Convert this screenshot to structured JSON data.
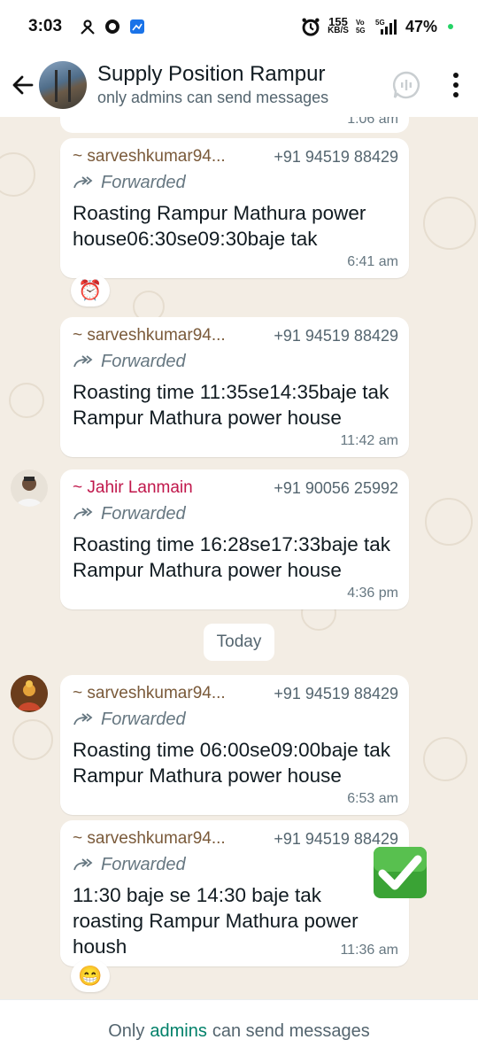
{
  "status_bar": {
    "time": "3:03",
    "net_speed_value": "155",
    "net_speed_unit": "KB/S",
    "volte": "Vo 5G",
    "network": "5G",
    "battery": "47%"
  },
  "header": {
    "group_name": "Supply Position Rampur",
    "subtitle": "only admins can send messages"
  },
  "chat": {
    "prev_time": "1:06 am",
    "forwarded_label": "Forwarded",
    "date_divider": "Today",
    "messages": [
      {
        "sender": "~ sarveshkumar94...",
        "phone": "+91 94519 88429",
        "text": "Roasting Rampur Mathura power house06:30se09:30baje tak",
        "time": "6:41 am",
        "reaction": "⏰"
      },
      {
        "sender": "~ sarveshkumar94...",
        "phone": "+91 94519 88429",
        "text": "Roasting time 11:35se14:35baje tak Rampur Mathura power house",
        "time": "11:42 am"
      },
      {
        "sender": "~ Jahir Lanmain",
        "phone": "+91 90056 25992",
        "text": "Roasting time 16:28se17:33baje tak Rampur Mathura power house",
        "time": "4:36 pm"
      },
      {
        "sender": "~ sarveshkumar94...",
        "phone": "+91 94519 88429",
        "text": "Roasting time 06:00se09:00baje tak Rampur Mathura power house",
        "time": "6:53 am"
      },
      {
        "sender": "~ sarveshkumar94...",
        "phone": "+91 94519 88429",
        "text": "11:30 baje se 14:30 baje tak roasting Rampur Mathura power housh",
        "time": "11:36 am",
        "reaction": "😁"
      }
    ]
  },
  "footer": {
    "prefix": "Only",
    "link": "admins",
    "suffix": "can send messages"
  },
  "colors": {
    "accent": "#008069",
    "chat_bg": "#f3ede4",
    "sender_brown": "#7a5a3a",
    "sender_red": "#c0174b"
  },
  "icons": {
    "back": "arrow-left-icon",
    "voice_chat": "voice-chat-icon",
    "menu": "more-vertical-icon",
    "forward": "forward-arrow-icon",
    "check": "green-check-icon"
  }
}
